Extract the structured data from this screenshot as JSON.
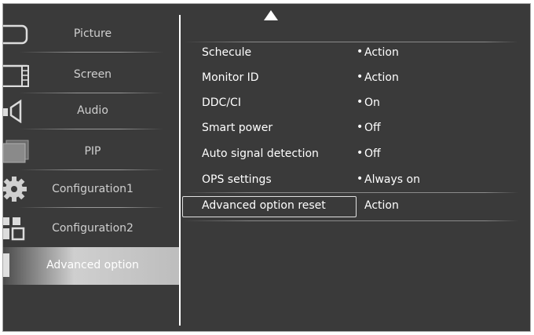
{
  "sidebar": {
    "items": [
      {
        "label": "Picture",
        "icon": "picture-icon",
        "selected": false
      },
      {
        "label": "Screen",
        "icon": "screen-icon",
        "selected": false
      },
      {
        "label": "Audio",
        "icon": "audio-icon",
        "selected": false
      },
      {
        "label": "PIP",
        "icon": "pip-icon",
        "selected": false
      },
      {
        "label": "Configuration1",
        "icon": "gear-icon",
        "selected": false
      },
      {
        "label": "Configuration2",
        "icon": "configuration2-icon",
        "selected": false
      },
      {
        "label": "Advanced option",
        "icon": "advanced-option-icon",
        "selected": true
      }
    ]
  },
  "options": {
    "scroll_up_icon": "up-arrow-icon",
    "bullet": "•",
    "rows": [
      {
        "name": "Schecule",
        "value": "Action"
      },
      {
        "name": "Monitor ID",
        "value": "Action"
      },
      {
        "name": "DDC/CI",
        "value": "On"
      },
      {
        "name": "Smart power",
        "value": "Off"
      },
      {
        "name": "Auto signal detection",
        "value": "Off"
      },
      {
        "name": "OPS settings",
        "value": "Always on"
      },
      {
        "name": "Advanced option reset",
        "value": "Action",
        "highlighted": true
      }
    ]
  },
  "colors": {
    "background": "#3a3a3a",
    "text": "#ffffff",
    "sidebar_text": "#cfcfcf",
    "selected_highlight": "#cfcfcf"
  }
}
